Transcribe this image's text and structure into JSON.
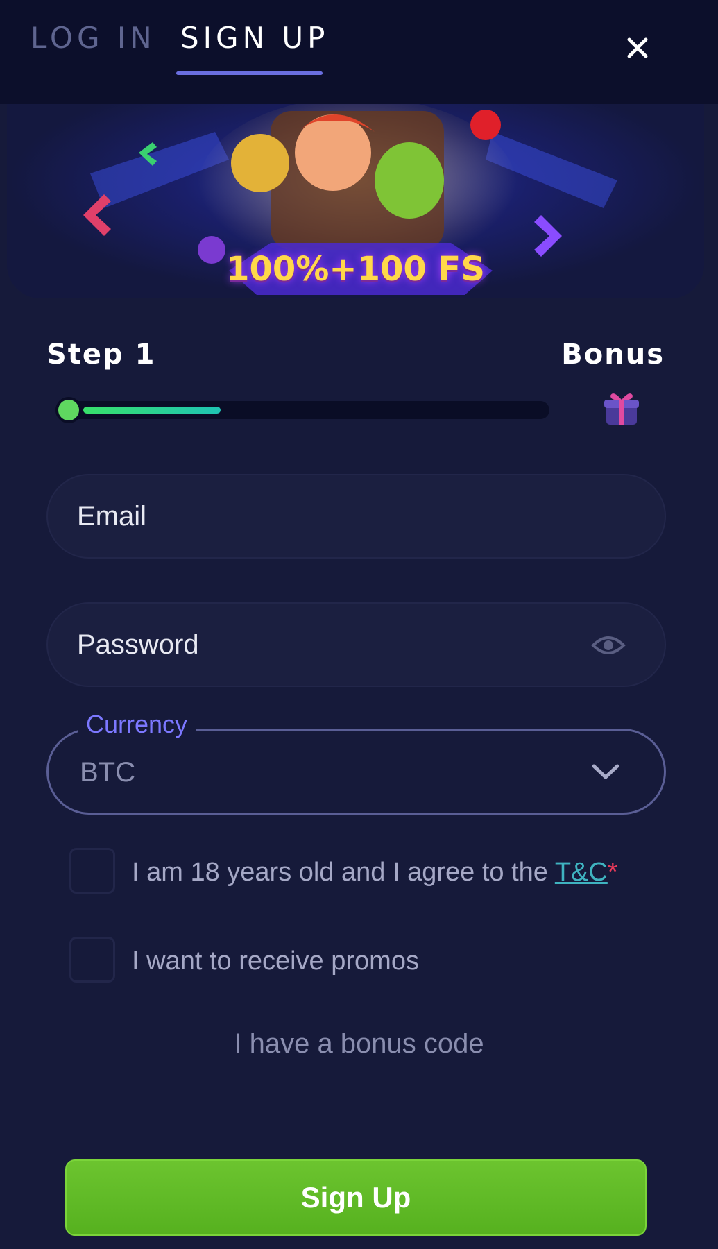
{
  "header": {
    "tabs": [
      {
        "label": "LOG IN",
        "active": false
      },
      {
        "label": "SIGN UP",
        "active": true
      }
    ],
    "close_icon": "close-icon"
  },
  "banner": {
    "promo_text": "100%+100 FS"
  },
  "progress": {
    "step_label": "Step 1",
    "bonus_label": "Bonus",
    "fill_percent": 32,
    "gift_icon": "gift-icon"
  },
  "form": {
    "email_placeholder": "Email",
    "password_placeholder": "Password",
    "eye_icon": "eye-icon",
    "currency_label": "Currency",
    "currency_value": "BTC",
    "chevron_icon": "chevron-down-icon",
    "age_text": "I am 18 years old and I agree to the",
    "terms_link": "T&C",
    "required_mark": "*",
    "promos_text": "I want to receive promos",
    "bonus_code_link": "I have a bonus code",
    "submit_label": "Sign Up"
  },
  "colors": {
    "accent": "#6a6ee0",
    "currency_label": "#7c78ff",
    "button": "#5cb824",
    "link": "#3fb3c0",
    "required": "#e83a5a",
    "background": "#161a3a"
  }
}
